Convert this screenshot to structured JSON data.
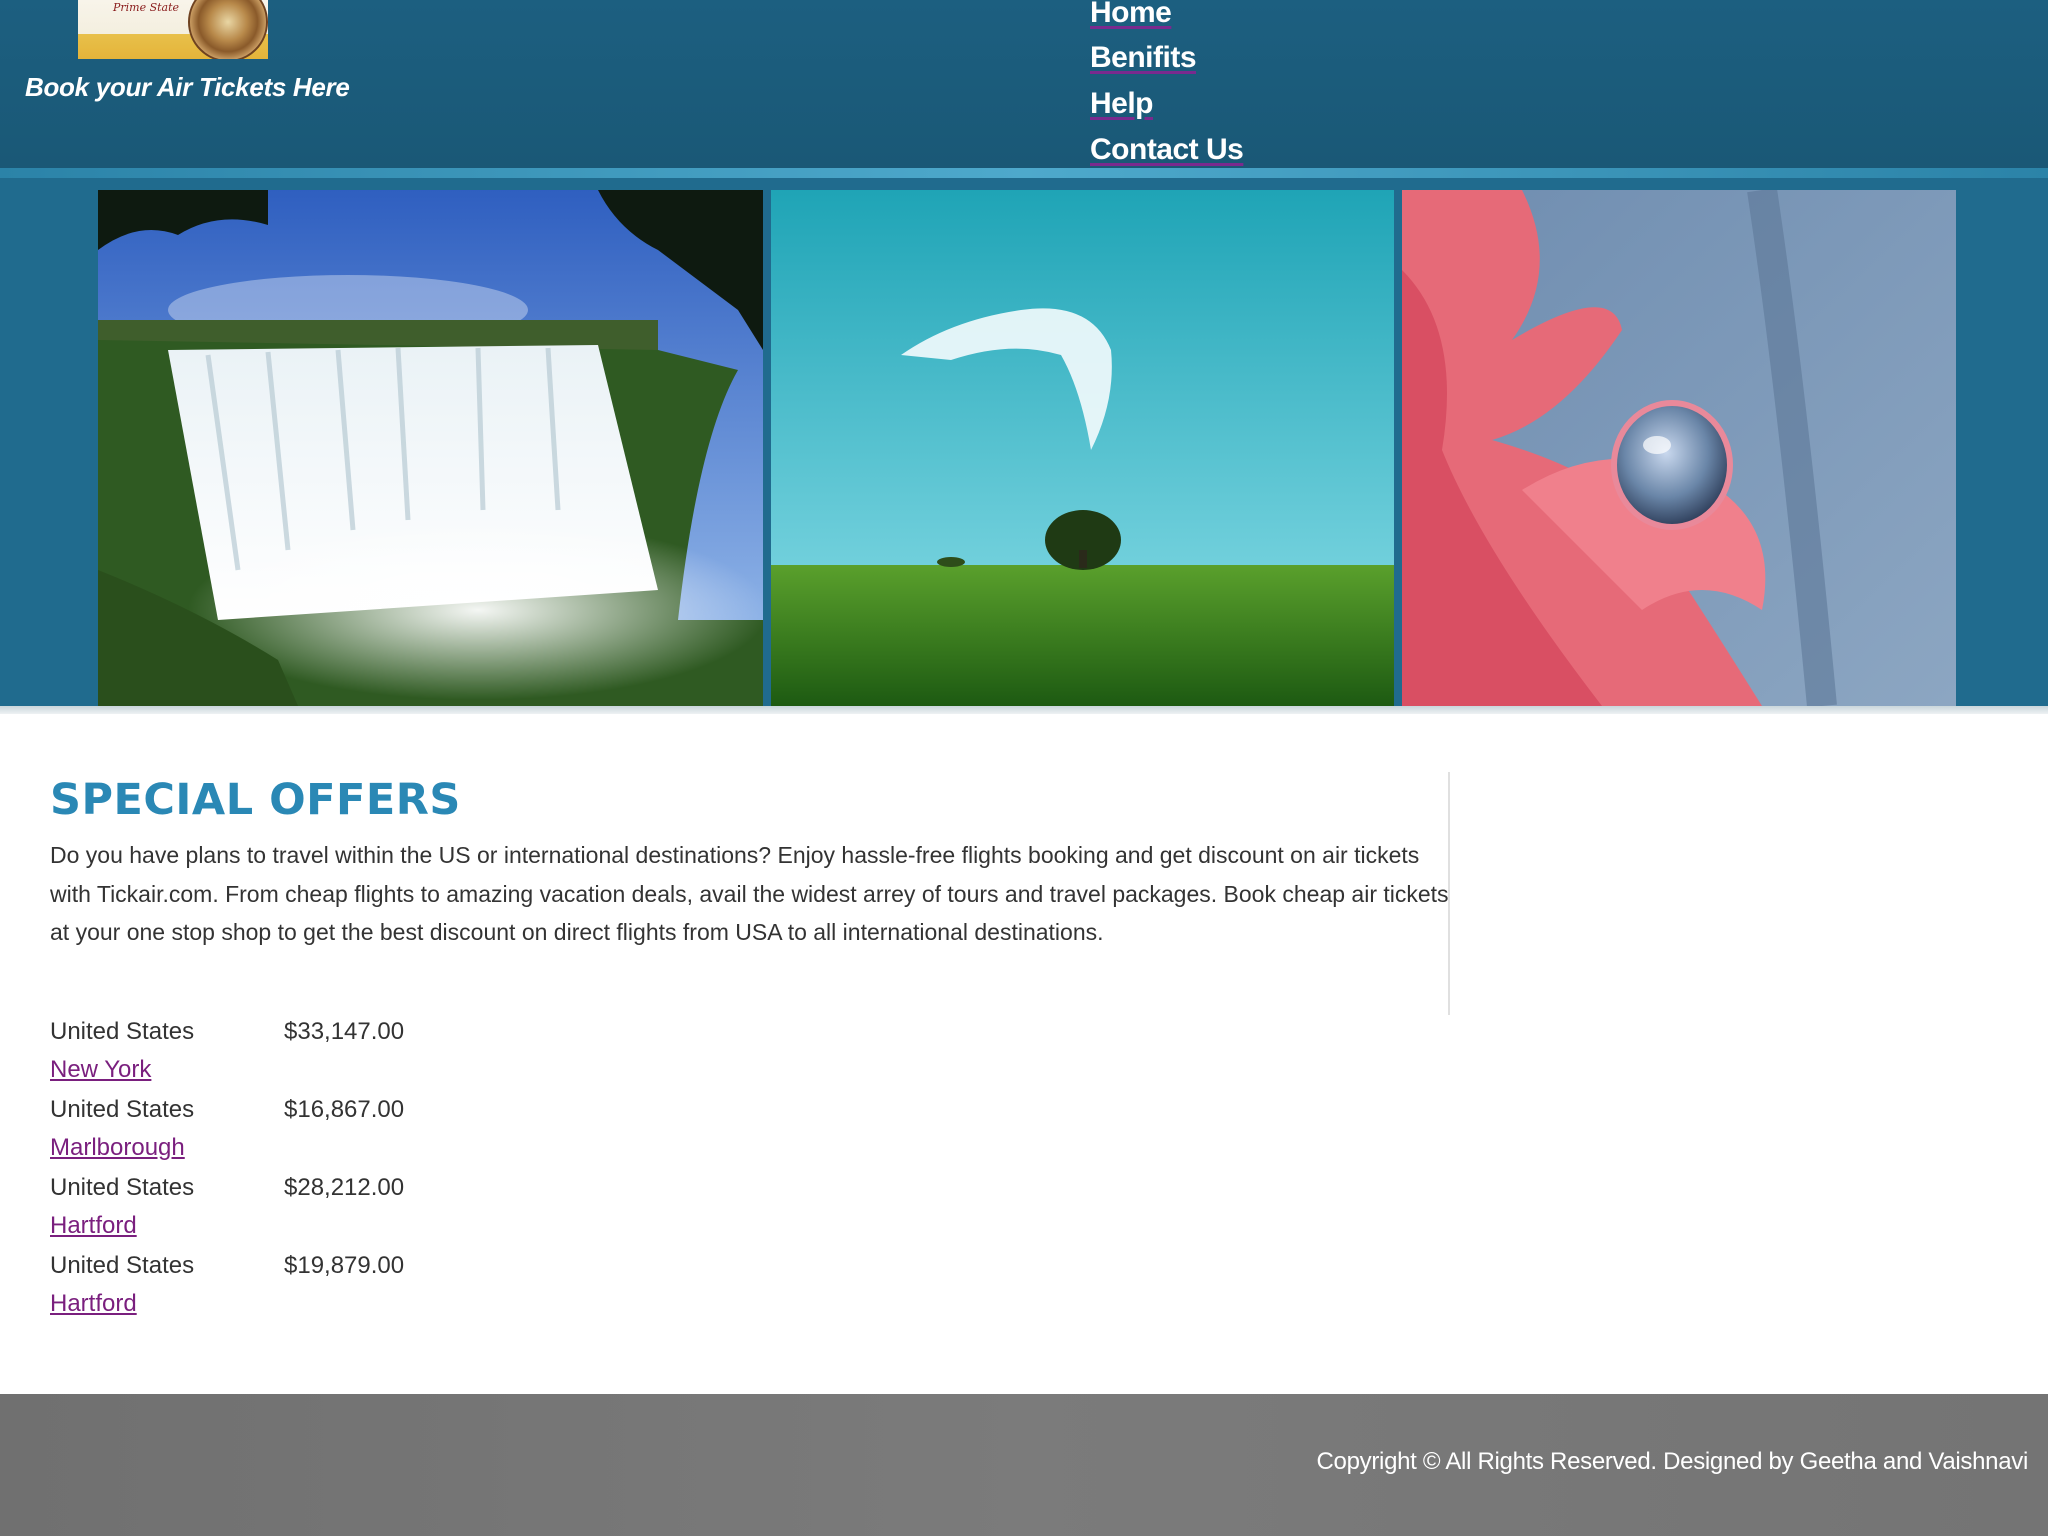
{
  "header": {
    "logo_text": "Prime State",
    "tagline": "Book your Air Tickets Here",
    "nav": [
      {
        "label": "Home"
      },
      {
        "label": "Benifits"
      },
      {
        "label": "Help"
      },
      {
        "label": "Contact Us"
      }
    ]
  },
  "banner": {
    "photos": [
      {
        "subject": "waterfall"
      },
      {
        "subject": "meadow-tree-sky"
      },
      {
        "subject": "pink-flower-waterdrop"
      }
    ]
  },
  "offers": {
    "title": "SPECIAL OFFERS",
    "description": "Do you have plans to travel within the US or international destinations? Enjoy hassle-free flights booking and get discount on air tickets with Tickair.com. From cheap flights to amazing vacation deals, avail the widest arrey of tours and travel packages. Book cheap air tickets at your one stop shop to get the best discount on direct flights from USA to all international destinations.",
    "items": [
      {
        "country": "United States",
        "price": "$33,147.00",
        "city": "New York"
      },
      {
        "country": "United States",
        "price": "$16,867.00",
        "city": "Marlborough"
      },
      {
        "country": "United States",
        "price": "$28,212.00",
        "city": "Hartford"
      },
      {
        "country": "United States",
        "price": "$19,879.00",
        "city": "Hartford"
      }
    ]
  },
  "footer": {
    "copyright": "Copyright © All Rights Reserved. Designed by Geetha and Vaishnavi"
  },
  "colors": {
    "header_bg": "#1c5f80",
    "banner_bg": "#206b8e",
    "title": "#2a88b5",
    "link": "#7a1f7e",
    "footer_bg": "#777777"
  }
}
